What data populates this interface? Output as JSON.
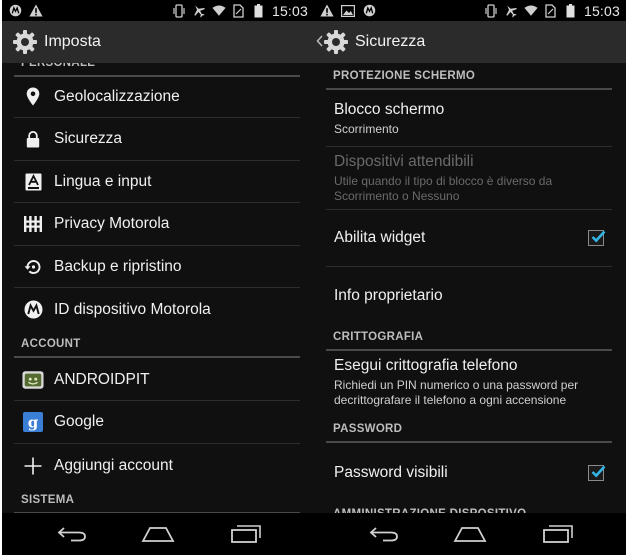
{
  "left": {
    "status": {
      "time": "15:03"
    },
    "actionbar": {
      "title": "Imposta"
    },
    "partial_header": "PERSONALE",
    "personal_items": [
      {
        "label": "Geolocalizzazione",
        "icon": "location-pin-icon"
      },
      {
        "label": "Sicurezza",
        "icon": "lock-icon"
      },
      {
        "label": "Lingua e input",
        "icon": "language-keyboard-icon"
      },
      {
        "label": "Privacy Motorola",
        "icon": "privacy-grid-icon"
      },
      {
        "label": "Backup e ripristino",
        "icon": "backup-restore-icon"
      },
      {
        "label": "ID dispositivo Motorola",
        "icon": "motorola-logo-icon"
      }
    ],
    "account_header": "ACCOUNT",
    "account_items": [
      {
        "label": "ANDROIDPIT",
        "icon": "androidpit-app-icon"
      },
      {
        "label": "Google",
        "icon": "google-g-icon"
      },
      {
        "label": "Aggiungi account",
        "icon": "plus-icon"
      }
    ],
    "system_header": "SISTEMA"
  },
  "right": {
    "status": {
      "time": "15:03"
    },
    "actionbar": {
      "title": "Sicurezza"
    },
    "screen_header": "PROTEZIONE SCHERMO",
    "screen_lock": {
      "title": "Blocco schermo",
      "summary": "Scorrimento"
    },
    "trusted_devices": {
      "title": "Dispositivi attendibili",
      "summary": "Utile quando il tipo di blocco è diverso da Scorrimento o Nessuno"
    },
    "widgets": {
      "title": "Abilita widget",
      "checked": true
    },
    "owner_info": {
      "title": "Info proprietario"
    },
    "crypto_header": "CRITTOGRAFIA",
    "encrypt": {
      "title": "Esegui crittografia telefono",
      "summary": "Richiedi un PIN numerico o una password per decrittografare il telefono a ogni accensione"
    },
    "password_header": "PASSWORD",
    "visible_passwords": {
      "title": "Password visibili",
      "checked": true
    },
    "partial_header": "AMMINISTRAZIONE DISPOSITIVO"
  },
  "colors": {
    "accent": "#33b5e5",
    "background": "#101010",
    "actionbar": "#2b2b2b"
  }
}
